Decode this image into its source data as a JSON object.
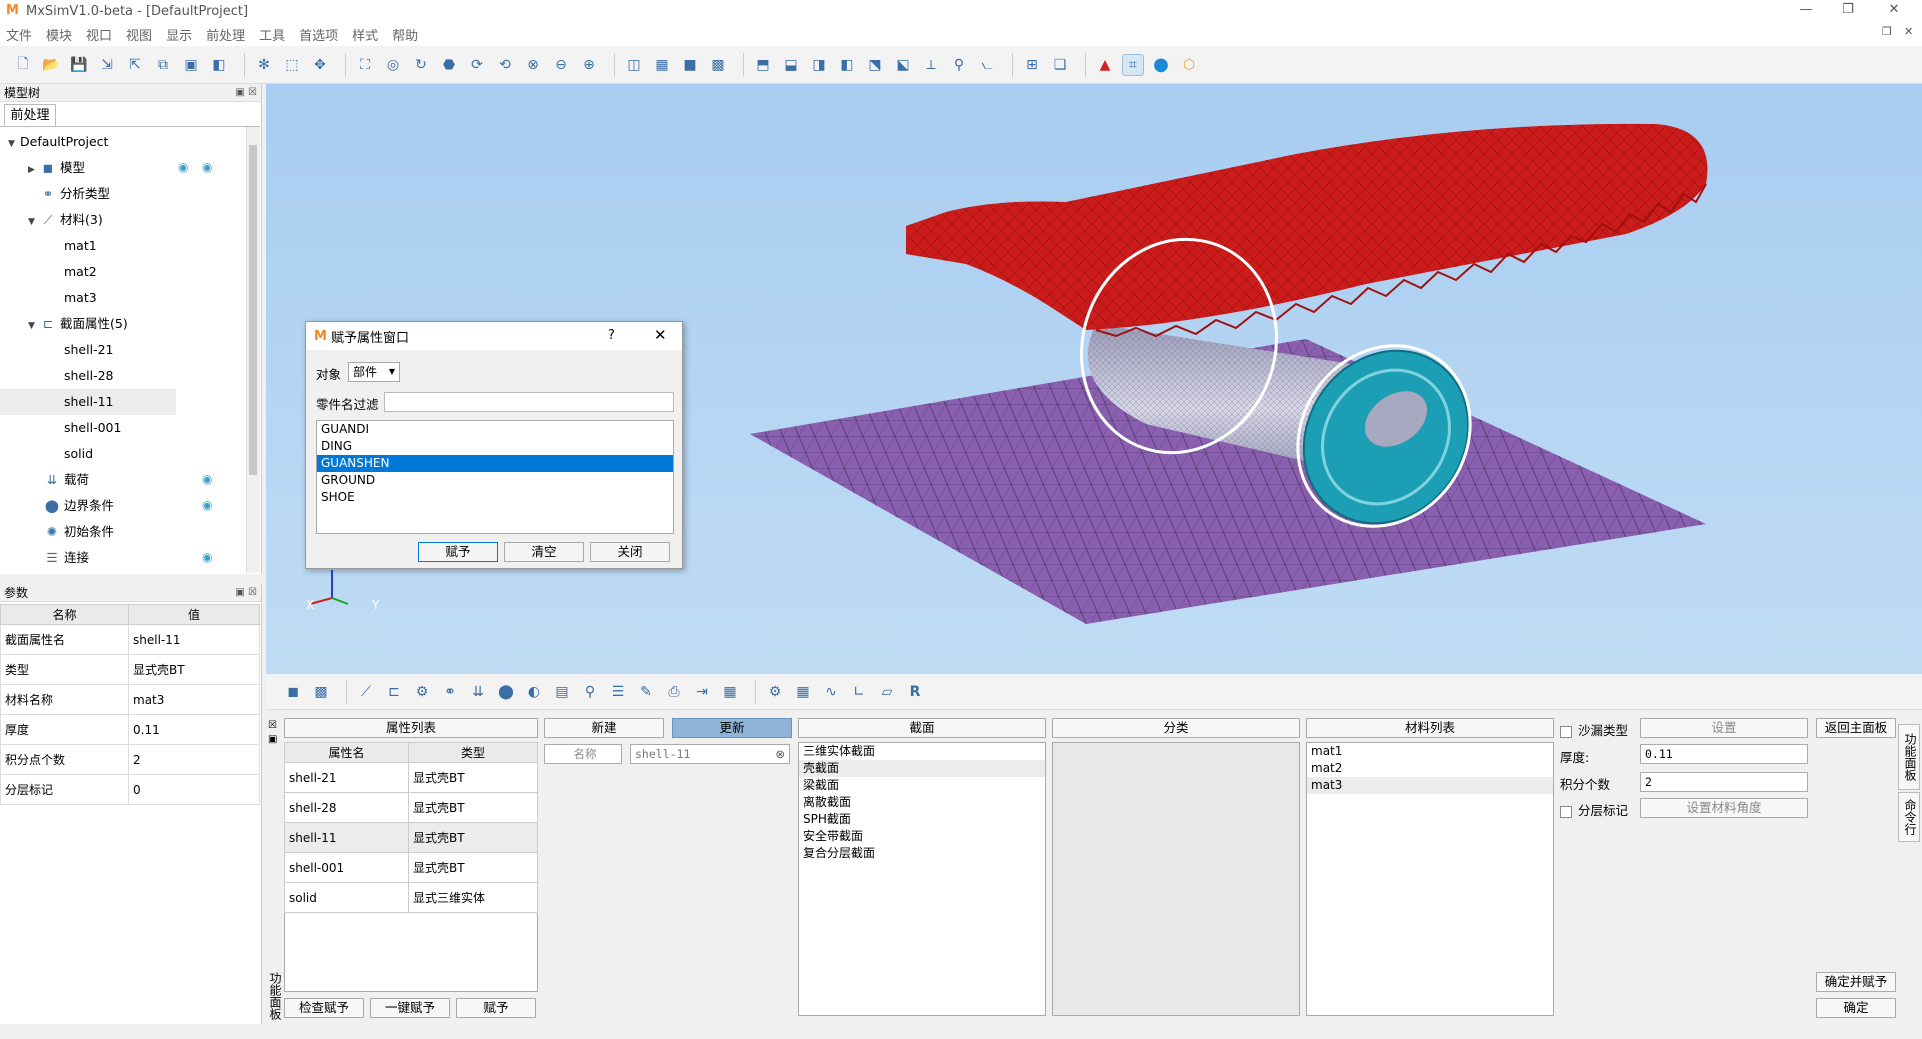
{
  "window": {
    "title": "MxSimV1.0-beta - [DefaultProject]",
    "min": "—",
    "max": "❐",
    "close": "✕"
  },
  "menu": [
    "文件",
    "模块",
    "视口",
    "视图",
    "显示",
    "前处理",
    "工具",
    "首选项",
    "样式",
    "帮助"
  ],
  "tree_panel": {
    "title": "模型树",
    "tab": "前处理",
    "root": "DefaultProject",
    "items": [
      {
        "label": "模型",
        "indent": 1
      },
      {
        "label": "分析类型",
        "indent": 1
      },
      {
        "label": "材料(3)",
        "indent": 1
      },
      {
        "label": "mat1",
        "indent": 2
      },
      {
        "label": "mat2",
        "indent": 2
      },
      {
        "label": "mat3",
        "indent": 2
      },
      {
        "label": "截面属性(5)",
        "indent": 1
      },
      {
        "label": "shell-21",
        "indent": 2
      },
      {
        "label": "shell-28",
        "indent": 2
      },
      {
        "label": "shell-11",
        "indent": 2
      },
      {
        "label": "shell-001",
        "indent": 2
      },
      {
        "label": "solid",
        "indent": 2
      },
      {
        "label": "载荷",
        "indent": 1
      },
      {
        "label": "边界条件",
        "indent": 1
      },
      {
        "label": "初始条件",
        "indent": 1
      },
      {
        "label": "连接",
        "indent": 1
      }
    ]
  },
  "param_panel": {
    "title": "参数",
    "col_name": "名称",
    "col_value": "值",
    "rows": [
      {
        "name": "截面属性名",
        "value": "shell-11"
      },
      {
        "name": "类型",
        "value": "显式壳BT"
      },
      {
        "name": "材料名称",
        "value": "mat3"
      },
      {
        "name": "厚度",
        "value": "0.11"
      },
      {
        "name": "积分点个数",
        "value": "2"
      },
      {
        "name": "分层标记",
        "value": "0"
      }
    ]
  },
  "viewport": {
    "axis_x": "X",
    "axis_y": "Y"
  },
  "dialog": {
    "title": "赋予属性窗口",
    "help": "?",
    "close": "✕",
    "object_label": "对象",
    "object_value": "部件",
    "filter_label": "零件名过滤",
    "parts": [
      "GUANDI",
      "DING",
      "GUANSHEN",
      "GROUND",
      "SHOE"
    ],
    "selected_part": "GUANSHEN",
    "btn_assign": "赋予",
    "btn_clear": "清空",
    "btn_close": "关闭"
  },
  "bottom": {
    "side_label": "功能面板",
    "attr_list_header": "属性列表",
    "col_attr_name": "属性名",
    "col_type": "类型",
    "attrs": [
      {
        "name": "shell-21",
        "type": "显式壳BT"
      },
      {
        "name": "shell-28",
        "type": "显式壳BT"
      },
      {
        "name": "shell-11",
        "type": "显式壳BT"
      },
      {
        "name": "shell-001",
        "type": "显式壳BT"
      },
      {
        "name": "solid",
        "type": "显式三维实体"
      }
    ],
    "btn_check": "检查赋予",
    "btn_onekey": "一键赋予",
    "btn_assign": "赋予",
    "btn_new": "新建",
    "btn_update": "更新",
    "name_label": "名称",
    "name_value": "shell-11",
    "section_header": "截面",
    "sections": [
      "三维实体截面",
      "壳截面",
      "梁截面",
      "离散截面",
      "SPH截面",
      "安全带截面",
      "复合分层截面"
    ],
    "selected_section": "壳截面",
    "category_header": "分类",
    "material_header": "材料列表",
    "materials": [
      "mat1",
      "mat2",
      "mat3"
    ],
    "selected_material": "mat3",
    "hourglass_label": "沙漏类型",
    "btn_setting": "设置",
    "btn_back": "返回主面板",
    "thickness_label": "厚度:",
    "thickness_value": "0.11",
    "ip_label": "积分个数",
    "ip_value": "2",
    "layer_label": "分层标记",
    "btn_mat_angle": "设置材料角度",
    "btn_confirm_assign": "确定并赋予",
    "btn_confirm": "确定",
    "tab_func": "功能面板",
    "tab_cmd": "命令行"
  },
  "colors": {
    "accent": "#0078d7",
    "update_btn": "#8fb4d8",
    "viewport_top": "#a8cdf0",
    "shoe": "#cc1b1b",
    "ground": "#8a5fb0",
    "can": "#b8b8d0",
    "cap": "#1c9fb4"
  }
}
